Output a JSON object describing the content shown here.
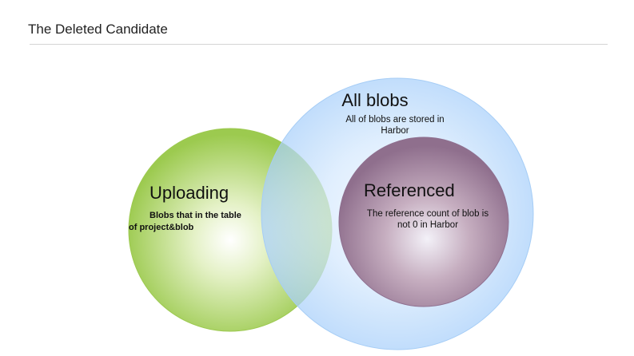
{
  "header": {
    "title": "The Deleted Candidate"
  },
  "diagram": {
    "all_blobs": {
      "title": "All blobs",
      "desc_line1": "All of blobs are stored in",
      "desc_line2": "Harbor",
      "color": "#b3d6fb"
    },
    "uploading": {
      "title": "Uploading",
      "desc_line1": "Blobs that in the table",
      "desc_line2": "of project&blob",
      "color": "#a7cf5a"
    },
    "referenced": {
      "title": "Referenced",
      "desc_line1": "The reference count of blob is",
      "desc_line2": "not 0 in Harbor",
      "color": "#9c7f98"
    }
  }
}
